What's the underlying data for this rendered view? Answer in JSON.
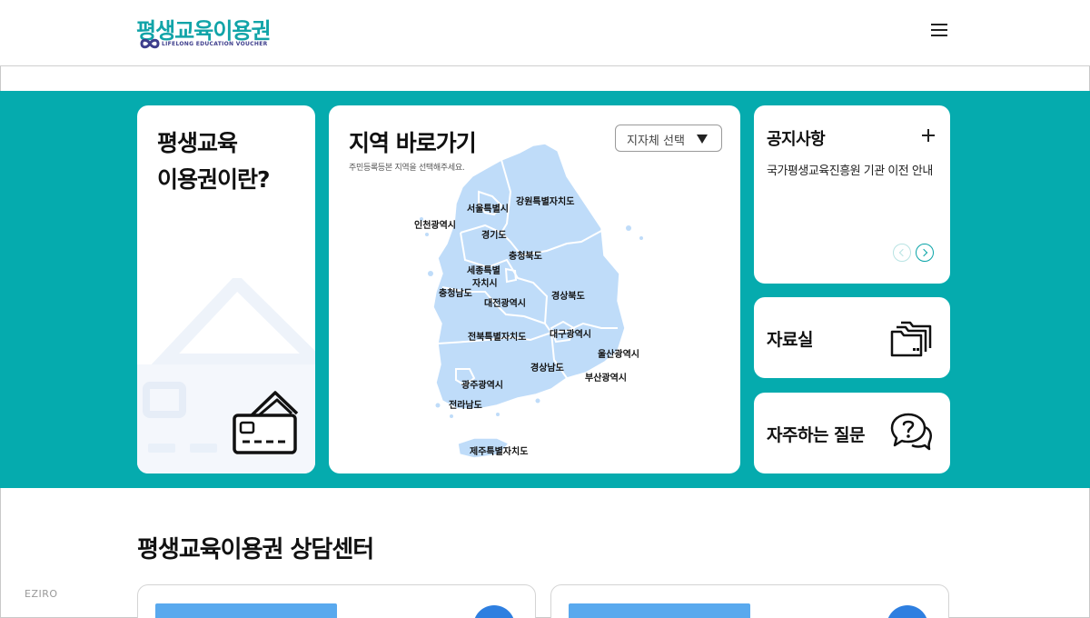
{
  "header": {
    "logo_main": "평생교육이용권",
    "logo_sub": "LIFELONG EDUCATION VOUCHER",
    "menu_icon": "hamburger-menu-icon"
  },
  "about": {
    "title": "평생교육\n이용권이란?",
    "icon": "credit-card-icon"
  },
  "map": {
    "title": "지역 바로가기",
    "subtitle": "주민등록등본 지역을 선택해주세요.",
    "select_label": "지자체 선택",
    "regions": {
      "seoul": "서울특별시",
      "gangwon": "강원특별자치도",
      "incheon": "인천광역시",
      "gyeonggi": "경기도",
      "chungbuk": "충청북도",
      "sejong_1": "세종특별",
      "sejong_2": "자치시",
      "chungnam": "충청남도",
      "daejeon": "대전광역시",
      "gyeongbuk": "경상북도",
      "daegu": "대구광역시",
      "jeonbuk": "전북특별자치도",
      "ulsan": "울산광역시",
      "gyeongnam": "경상남도",
      "gwangju": "광주광역시",
      "busan": "부산광역시",
      "jeonnam": "전라남도",
      "jeju": "제주특별자치도"
    }
  },
  "notice": {
    "title": "공지사항",
    "item": "국가평생교육진흥원 기관 이전 안내",
    "more_icon": "plus-icon",
    "prev_icon": "chevron-left-icon",
    "next_icon": "chevron-right-icon"
  },
  "resources": {
    "title": "자료실",
    "icon": "folder-icon"
  },
  "faq": {
    "title": "자주하는 질문",
    "icon": "question-bubble-icon"
  },
  "counsel": {
    "title": "평생교육이용권 상담센터"
  },
  "watermark": "EZIRO",
  "colors": {
    "brand_teal": "#05abae",
    "map_fill": "#bfdcf9",
    "counsel_blue": "#59a9ee"
  }
}
